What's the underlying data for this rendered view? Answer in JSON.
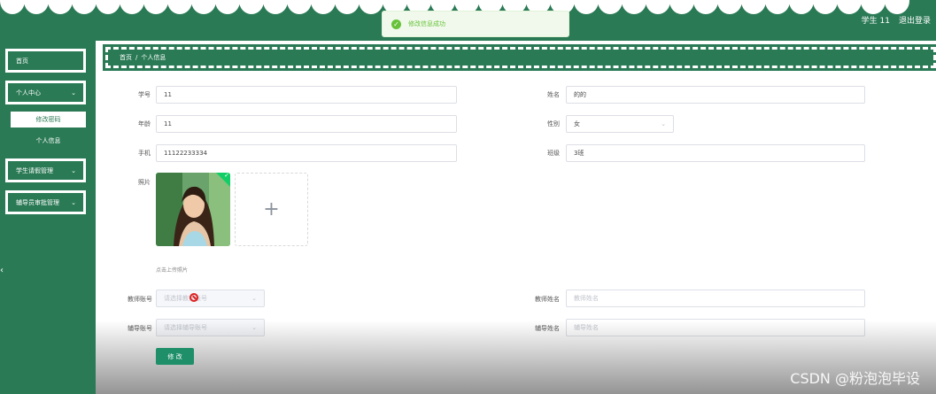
{
  "header": {
    "user": "学生 11",
    "logout": "退出登录"
  },
  "toast": {
    "message": "修改信息成功",
    "icon": "check-circle-icon"
  },
  "sidebar": {
    "items": [
      {
        "label": "首页"
      },
      {
        "label": "个人中心",
        "children": [
          "修改密码",
          "个人信息"
        ]
      },
      {
        "label": "学生请假管理"
      },
      {
        "label": "辅导员审批管理"
      }
    ]
  },
  "breadcrumb": {
    "home": "首页",
    "separator": "/",
    "current": "个人信息"
  },
  "form": {
    "student_id": {
      "label": "学号",
      "value": "11"
    },
    "name": {
      "label": "姓名",
      "value": "的的"
    },
    "age": {
      "label": "年龄",
      "value": "11"
    },
    "gender": {
      "label": "性别",
      "value": "女"
    },
    "phone": {
      "label": "手机",
      "value": "11122233334"
    },
    "class": {
      "label": "班级",
      "value": "3班"
    },
    "photo": {
      "label": "照片",
      "tip": "点击上传照片",
      "add_icon": "+"
    },
    "teacher_account": {
      "label": "教师账号",
      "placeholder": "请选择教师账号"
    },
    "teacher_name": {
      "label": "教师姓名",
      "placeholder": "教师姓名"
    },
    "counselor_account": {
      "label": "辅导账号",
      "placeholder": "请选择辅导账号"
    },
    "counselor_name": {
      "label": "辅导姓名",
      "placeholder": "辅导姓名"
    },
    "submit": "修 改"
  },
  "watermark": "CSDN @粉泡泡毕设",
  "colors": {
    "primary": "#2a7a55",
    "button": "#1f8f6a",
    "success": "#67c23a"
  }
}
